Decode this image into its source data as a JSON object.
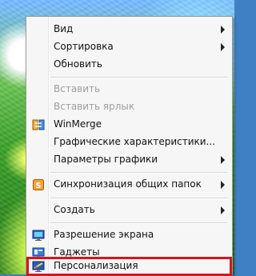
{
  "menu": {
    "items": [
      {
        "label": "Вид",
        "enabled": true,
        "submenu": true,
        "icon": null
      },
      {
        "label": "Сортировка",
        "enabled": true,
        "submenu": true,
        "icon": null
      },
      {
        "label": "Обновить",
        "enabled": true,
        "submenu": false,
        "icon": null
      },
      {
        "label": "Вставить",
        "enabled": false,
        "submenu": false,
        "icon": null
      },
      {
        "label": "Вставить ярлык",
        "enabled": false,
        "submenu": false,
        "icon": null
      },
      {
        "label": "WinMerge",
        "enabled": true,
        "submenu": false,
        "icon": "winmerge-icon"
      },
      {
        "label": "Графические характеристики...",
        "enabled": true,
        "submenu": false,
        "icon": null
      },
      {
        "label": "Параметры графики",
        "enabled": true,
        "submenu": true,
        "icon": null
      },
      {
        "label": "Синхронизация общих папок",
        "enabled": true,
        "submenu": true,
        "icon": "sync-folders-icon"
      },
      {
        "label": "Создать",
        "enabled": true,
        "submenu": true,
        "icon": null
      },
      {
        "label": "Разрешение экрана",
        "enabled": true,
        "submenu": false,
        "icon": "screen-resolution-icon"
      },
      {
        "label": "Гаджеты",
        "enabled": true,
        "submenu": false,
        "icon": "gadgets-icon"
      },
      {
        "label": "Персонализация",
        "enabled": true,
        "submenu": false,
        "icon": "personalization-icon",
        "highlighted": true
      }
    ],
    "highlight_color": "#d9141d"
  }
}
